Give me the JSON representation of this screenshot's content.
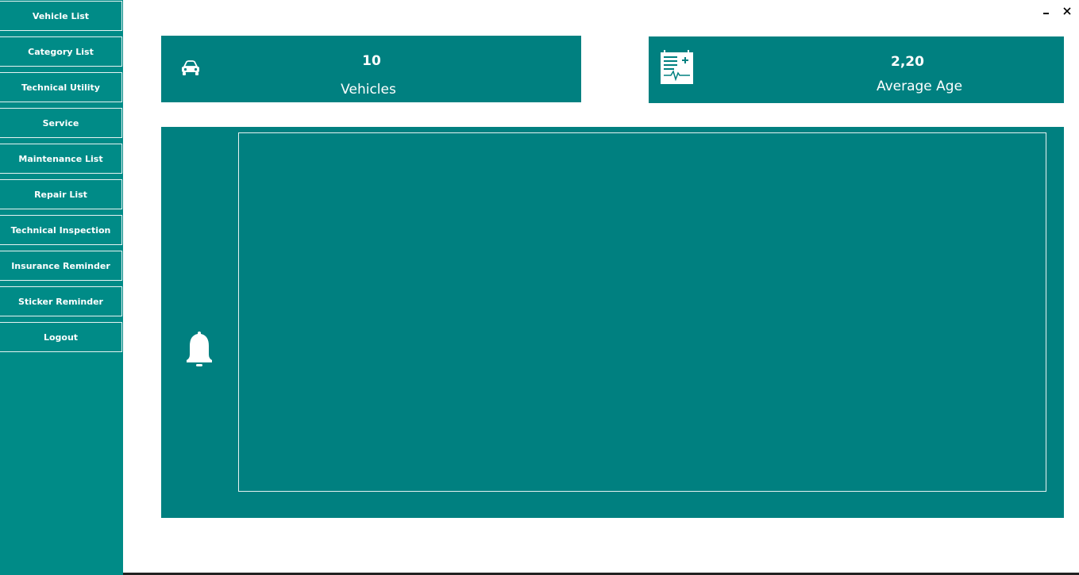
{
  "window": {
    "minimize_label": "‗",
    "close_label": "✕"
  },
  "sidebar": {
    "items": [
      {
        "label": "Vehicle List"
      },
      {
        "label": "Category List"
      },
      {
        "label": "Technical Utility"
      },
      {
        "label": "Service"
      },
      {
        "label": "Maintenance List"
      },
      {
        "label": "Repair List"
      },
      {
        "label": "Technical Inspection"
      },
      {
        "label": "Insurance Reminder"
      },
      {
        "label": "Sticker Reminder"
      },
      {
        "label": "Logout"
      }
    ]
  },
  "cards": {
    "vehicles": {
      "value": "10",
      "label": "Vehicles",
      "icon": "car-icon"
    },
    "average_age": {
      "value": "2,20",
      "label": "Average Age",
      "icon": "medical-report-icon"
    }
  },
  "notifications": {
    "icon": "bell-icon"
  },
  "colors": {
    "sidebar": "#008b87",
    "card": "#008080",
    "text": "#ffffff"
  }
}
